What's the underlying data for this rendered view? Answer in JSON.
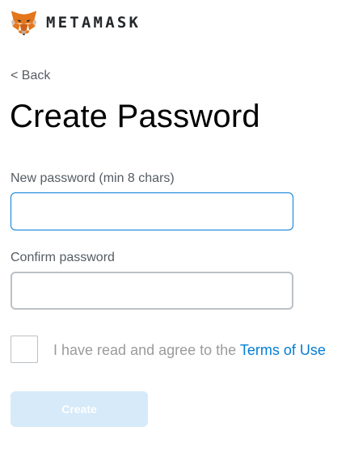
{
  "header": {
    "brand": "METAMASK",
    "logo_icon": "metamask-fox-icon"
  },
  "nav": {
    "back_label": "< Back"
  },
  "page": {
    "title": "Create Password"
  },
  "form": {
    "new_password": {
      "label": "New password (min 8 chars)",
      "value": "",
      "placeholder": ""
    },
    "confirm_password": {
      "label": "Confirm password",
      "value": "",
      "placeholder": ""
    },
    "terms": {
      "checked": false,
      "prefix": "I have read and agree to the ",
      "link_label": "Terms of Use"
    },
    "submit_label": "Create",
    "submit_disabled": true
  },
  "colors": {
    "accent": "#037dd6",
    "focused_border": "#037dd6",
    "default_border": "#bbc0c5",
    "disabled_button": "#d6eaf9",
    "fox_orange": "#e2761b"
  }
}
